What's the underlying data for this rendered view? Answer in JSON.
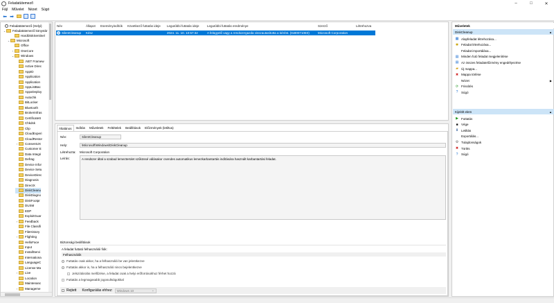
{
  "window": {
    "title": "Feladatütemező",
    "controls": [
      "–",
      "□",
      "✕"
    ]
  },
  "menu": [
    "Fájl",
    "Művelet",
    "Nézet",
    "Súgó"
  ],
  "toolbar": {
    "icons": [
      "back-arrow-icon",
      "forward-arrow-icon",
      "folder-icon",
      "help-icon",
      "properties-icon"
    ]
  },
  "tree": {
    "root": "Feladatütemező (Helyi)",
    "library": "Feladatütemező könyvtár",
    "items": [
      {
        "label": "HardDiskSentinel",
        "depth": 2,
        "exp": ""
      },
      {
        "label": "Microsoft",
        "depth": 1,
        "exp": "⌄"
      },
      {
        "label": "Office",
        "depth": 2,
        "exp": ""
      },
      {
        "label": "OneCore",
        "depth": 2,
        "exp": "›"
      },
      {
        "label": "Windows",
        "depth": 2,
        "exp": "⌄"
      },
      {
        "label": ".NET Framew",
        "depth": 3,
        "exp": ""
      },
      {
        "label": "Active Direc",
        "depth": 3,
        "exp": ""
      },
      {
        "label": "AppID",
        "depth": 3,
        "exp": ""
      },
      {
        "label": "Application",
        "depth": 3,
        "exp": ""
      },
      {
        "label": "Application",
        "depth": 3,
        "exp": ""
      },
      {
        "label": "AppListBac",
        "depth": 3,
        "exp": ""
      },
      {
        "label": "AppxDeploy",
        "depth": 3,
        "exp": ""
      },
      {
        "label": "Autochk",
        "depth": 3,
        "exp": ""
      },
      {
        "label": "BitLocker",
        "depth": 3,
        "exp": ""
      },
      {
        "label": "Bluetooth",
        "depth": 3,
        "exp": ""
      },
      {
        "label": "BrokerInfras",
        "depth": 3,
        "exp": ""
      },
      {
        "label": "CertificateS",
        "depth": 3,
        "exp": ""
      },
      {
        "label": "Chkdsk",
        "depth": 3,
        "exp": ""
      },
      {
        "label": "Clip",
        "depth": 3,
        "exp": ""
      },
      {
        "label": "CloudExperi",
        "depth": 3,
        "exp": ""
      },
      {
        "label": "CloudRestor",
        "depth": 3,
        "exp": ""
      },
      {
        "label": "ConsentUX",
        "depth": 3,
        "exp": "›"
      },
      {
        "label": "Customer E",
        "depth": 3,
        "exp": ""
      },
      {
        "label": "Data Integri",
        "depth": 3,
        "exp": ""
      },
      {
        "label": "Defrag",
        "depth": 3,
        "exp": ""
      },
      {
        "label": "Device Infor",
        "depth": 3,
        "exp": ""
      },
      {
        "label": "Device Setu",
        "depth": 3,
        "exp": ""
      },
      {
        "label": "DeviceDirec",
        "depth": 3,
        "exp": ""
      },
      {
        "label": "Diagnosis",
        "depth": 3,
        "exp": ""
      },
      {
        "label": "DirectX",
        "depth": 3,
        "exp": ""
      },
      {
        "label": "DiskCleanu",
        "depth": 3,
        "exp": "",
        "selected": true
      },
      {
        "label": "DiskDiagno",
        "depth": 3,
        "exp": ""
      },
      {
        "label": "DiskFootpr",
        "depth": 3,
        "exp": ""
      },
      {
        "label": "DUSM",
        "depth": 3,
        "exp": ""
      },
      {
        "label": "EDP",
        "depth": 3,
        "exp": ""
      },
      {
        "label": "ExploitGuar",
        "depth": 3,
        "exp": ""
      },
      {
        "label": "Feedback",
        "depth": 3,
        "exp": "›"
      },
      {
        "label": "File Classifi",
        "depth": 3,
        "exp": ""
      },
      {
        "label": "FileHistory",
        "depth": 3,
        "exp": ""
      },
      {
        "label": "Flighting",
        "depth": 3,
        "exp": "›"
      },
      {
        "label": "HelloFace",
        "depth": 3,
        "exp": ""
      },
      {
        "label": "Input",
        "depth": 3,
        "exp": ""
      },
      {
        "label": "InstallServi",
        "depth": 3,
        "exp": ""
      },
      {
        "label": "Internationa",
        "depth": 3,
        "exp": ""
      },
      {
        "label": "LanguageC",
        "depth": 3,
        "exp": ""
      },
      {
        "label": "License Ma",
        "depth": 3,
        "exp": ""
      },
      {
        "label": "Live",
        "depth": 3,
        "exp": "›"
      },
      {
        "label": "Location",
        "depth": 3,
        "exp": ""
      },
      {
        "label": "Maintenanc",
        "depth": 3,
        "exp": ""
      },
      {
        "label": "Manageme",
        "depth": 3,
        "exp": "›"
      }
    ]
  },
  "tasklist": {
    "columns": [
      "Név",
      "Állapot",
      "Eseményindítók",
      "Következő futtatás ideje",
      "Legutóbbi futtatás ideje",
      "Legutóbbi futtatás eredménye",
      "Szerző",
      "Létrehozva"
    ],
    "rows": [
      {
        "name": "SilentCleanup",
        "status": "Kész",
        "triggers": "",
        "next_run": "",
        "last_run": "2024. 11. 10. 10:57:32",
        "last_result": "A felügyelő vagy a rendszergazda visszautasította a kérést. (0x800710E0)",
        "author": "Microsoft Corporation",
        "created": ""
      }
    ]
  },
  "detail": {
    "tabs": [
      "Általános",
      "Indítás",
      "Műveletek",
      "Feltételek",
      "Beállítások",
      "Előzmények (letiltva)"
    ],
    "name_label": "Név:",
    "name_value": "SilentCleanup",
    "location_label": "Hely:",
    "location_value": "\\Microsoft\\Windows\\DiskCleanup",
    "author_label": "Létrehozta:",
    "author_value": "Microsoft Corporation",
    "desc_label": "Leírás:",
    "desc_value": "A rendszer által a szabad lemezterület szűkössé válásakor csendes automatikus lemezkarbantartás indítására használt karbantartási feladat.",
    "security_title": "Biztonsági beállítások",
    "run_account_label": "A feladat futtató felhasználói fiók:",
    "run_account_value": "Felhasználók",
    "opt_logged_on": "Futtatás csak akkor, ha a felhasználó be van jelentkezve",
    "opt_any": "Futtatás akkor is, ha a felhasználó nincs bejelentkezve",
    "opt_no_password": "Jelszótárolás mellőzése, a feladat csak a helyi erőforrásokhoz férhet hozzá",
    "opt_highest": "Futtatás a legmagasabb jogosultságokkal",
    "hidden_label": "Rejtett",
    "config_label": "Konfigurálás ehhez:",
    "config_value": "Windows 10"
  },
  "actions": {
    "header": "Műveletek",
    "group1": "DiskCleanup",
    "group1_items": [
      {
        "icon": "▦",
        "color": "#1e6fd0",
        "label": "Alapfeladat létrehozása..."
      },
      {
        "icon": "✱",
        "color": "#c8a000",
        "label": "Feladat létrehozása..."
      },
      {
        "icon": "",
        "color": "#000",
        "label": "Feladat importálása..."
      },
      {
        "icon": "▤",
        "color": "#1e6fd0",
        "label": "Minden futó feladat megjelenítése"
      },
      {
        "icon": "▤",
        "color": "#1e6fd0",
        "label": "Az összes feladatelőzmény engedélyezése"
      },
      {
        "icon": "▰",
        "color": "#d4a216",
        "label": "Új mappa..."
      },
      {
        "icon": "✖",
        "color": "#d02020",
        "label": "Mappa törlése"
      },
      {
        "icon": "",
        "color": "#000",
        "label": "Nézet"
      },
      {
        "icon": "⟳",
        "color": "#2a9a2a",
        "label": "Frissítés"
      },
      {
        "icon": "?",
        "color": "#1e6fd0",
        "label": "Súgó"
      }
    ],
    "group2": "Kijelölt elem",
    "group2_items": [
      {
        "icon": "▶",
        "color": "#1e9a1e",
        "label": "Futtatás"
      },
      {
        "icon": "■",
        "color": "#1a1a1a",
        "label": "Vége"
      },
      {
        "icon": "⬇",
        "color": "#2a5a9a",
        "label": "Letiltás"
      },
      {
        "icon": "",
        "color": "#000",
        "label": "Exportálás..."
      },
      {
        "icon": "⚙",
        "color": "#666",
        "label": "Tulajdonságok"
      },
      {
        "icon": "✖",
        "color": "#d02020",
        "label": "Törlés"
      },
      {
        "icon": "?",
        "color": "#1e6fd0",
        "label": "Súgó"
      }
    ]
  }
}
